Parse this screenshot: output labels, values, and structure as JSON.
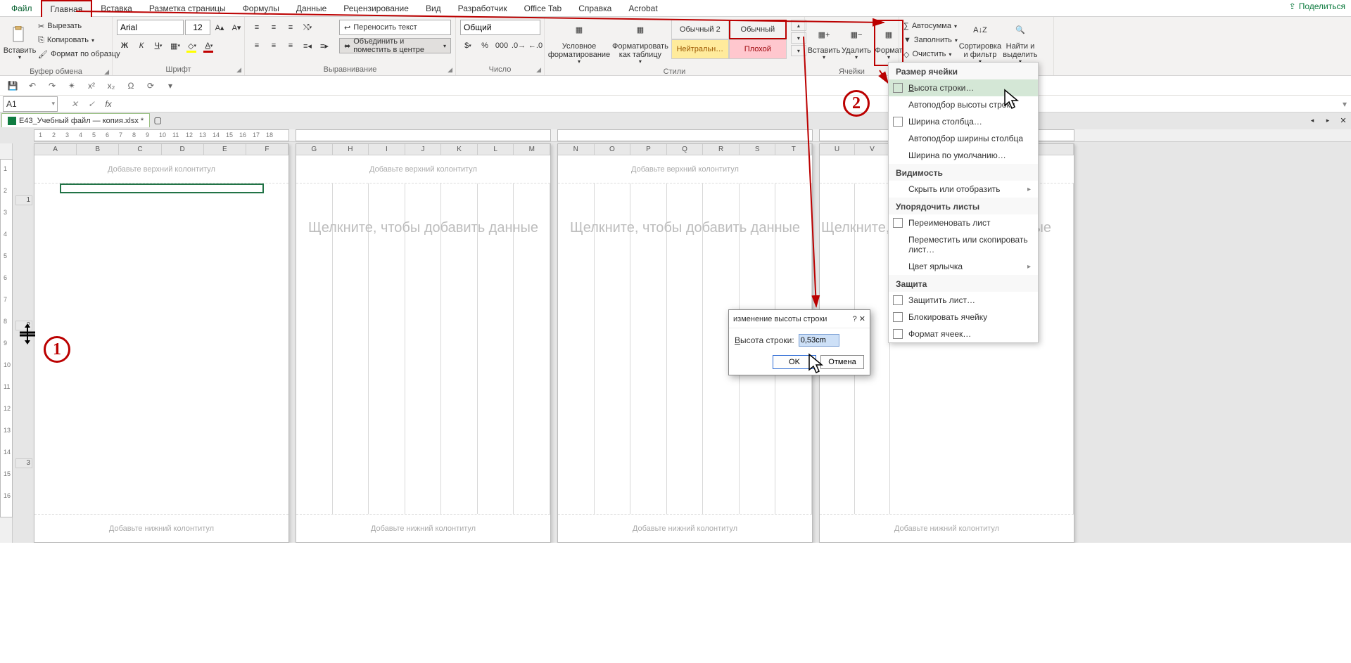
{
  "tabs": {
    "file": "Файл",
    "home": "Главная",
    "insert": "Вставка",
    "layout": "Разметка страницы",
    "formulas": "Формулы",
    "data": "Данные",
    "review": "Рецензирование",
    "view": "Вид",
    "developer": "Разработчик",
    "officetab": "Office Tab",
    "help": "Справка",
    "acrobat": "Acrobat"
  },
  "share": "Поделиться",
  "ribbon": {
    "clipboard": {
      "paste": "Вставить",
      "cut": "Вырезать",
      "copy": "Копировать",
      "painter": "Формат по образцу",
      "label": "Буфер обмена"
    },
    "font": {
      "name": "Arial",
      "size": "12",
      "label": "Шрифт"
    },
    "alignment": {
      "wrap": "Переносить текст",
      "merge": "Объединить и поместить в центре",
      "label": "Выравнивание"
    },
    "number": {
      "format": "Общий",
      "label": "Число"
    },
    "styles": {
      "cond": "Условное форматирование",
      "table": "Форматировать как таблицу",
      "normal2": "Обычный 2",
      "normal": "Обычный",
      "neutral": "Нейтральн…",
      "bad": "Плохой",
      "label": "Стили"
    },
    "cells": {
      "insert": "Вставить",
      "delete": "Удалить",
      "format": "Формат",
      "label": "Ячейки"
    },
    "editing": {
      "autosum": "Автосумма",
      "fill": "Заполнить",
      "clear": "Очистить",
      "sort": "Сортировка и фильтр",
      "find": "Найти и выделить"
    }
  },
  "namebox": "A1",
  "workbook_tab": "E43_Учебный файл — копия.xlsx *",
  "page": {
    "top_header": "Добавьте верхний колонтитул",
    "bottom_footer": "Добавьте нижний колонтитул",
    "click_prompt": "Щелкните, чтобы добавить данные"
  },
  "cols_page1": [
    "A",
    "B",
    "C",
    "D",
    "E",
    "F"
  ],
  "cols_page2": [
    "G",
    "H",
    "I",
    "J",
    "K",
    "L",
    "M"
  ],
  "cols_page3": [
    "N",
    "O",
    "P",
    "Q",
    "R",
    "S",
    "T"
  ],
  "cols_page4": [
    "U",
    "V"
  ],
  "ruler_ticks": [
    "1",
    "2",
    "3",
    "4",
    "5",
    "6",
    "7",
    "8",
    "9",
    "10",
    "11",
    "12",
    "13",
    "14",
    "15",
    "16",
    "17",
    "18"
  ],
  "vruler_row_labels": [
    "1",
    "2",
    "3"
  ],
  "vruler_ticks": [
    "1",
    "2",
    "3",
    "4",
    "5",
    "6",
    "7",
    "8",
    "9",
    "10",
    "11",
    "12",
    "13",
    "14",
    "15",
    "16"
  ],
  "menu": {
    "size_title": "Размер ячейки",
    "row_height": "Высота строки…",
    "autofit_row": "Автоподбор высоты строки",
    "col_width": "Ширина столбца…",
    "autofit_col": "Автоподбор ширины столбца",
    "default_width": "Ширина по умолчанию…",
    "visibility_title": "Видимость",
    "hide": "Скрыть или отобразить",
    "organize_title": "Упорядочить листы",
    "rename": "Переименовать лист",
    "move": "Переместить или скопировать лист…",
    "tab_color": "Цвет ярлычка",
    "protection_title": "Защита",
    "protect_sheet": "Защитить лист…",
    "lock_cell": "Блокировать ячейку",
    "format_cells": "Формат ячеек…"
  },
  "dialog": {
    "title": "изменение высоты строки",
    "label": "Высота строки:",
    "value": "0,53cm",
    "ok": "OK",
    "cancel": "Отмена"
  },
  "callouts": {
    "one": "1",
    "two": "2"
  }
}
